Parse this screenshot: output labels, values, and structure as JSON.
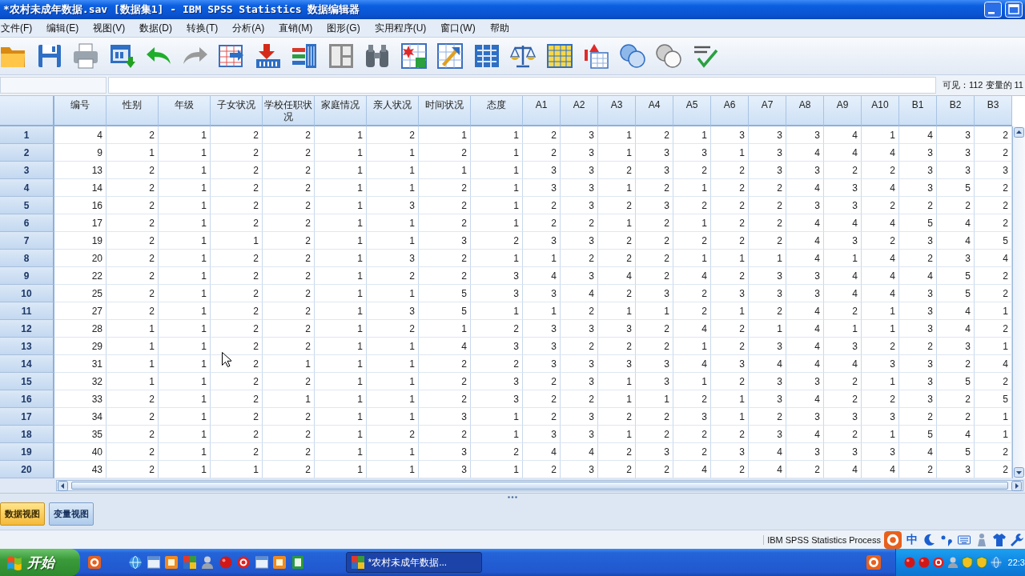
{
  "window": {
    "title": "*农村未成年数据.sav [数据集1] - IBM SPSS Statistics 数据编辑器"
  },
  "menu": [
    "文件(F)",
    "编辑(E)",
    "视图(V)",
    "数据(D)",
    "转换(T)",
    "分析(A)",
    "直销(M)",
    "图形(G)",
    "实用程序(U)",
    "窗口(W)",
    "帮助"
  ],
  "toolbar": [
    {
      "kind": "open",
      "disabled": false
    },
    {
      "kind": "save",
      "disabled": false
    },
    {
      "kind": "print",
      "disabled": false
    },
    {
      "kind": "recall",
      "disabled": false
    },
    {
      "kind": "undo",
      "disabled": false
    },
    {
      "kind": "redo",
      "disabled": true
    },
    {
      "kind": "gotocase",
      "disabled": false
    },
    {
      "kind": "gotovar",
      "disabled": false
    },
    {
      "kind": "variables",
      "disabled": false
    },
    {
      "kind": "descriptives",
      "disabled": true
    },
    {
      "kind": "find",
      "disabled": false
    },
    {
      "kind": "insertcases",
      "disabled": false
    },
    {
      "kind": "insertvar",
      "disabled": false
    },
    {
      "kind": "split",
      "disabled": false
    },
    {
      "kind": "weight",
      "disabled": false
    },
    {
      "kind": "select",
      "disabled": false
    },
    {
      "kind": "labels",
      "disabled": false
    },
    {
      "kind": "sets",
      "disabled": false
    },
    {
      "kind": "showall",
      "disabled": true
    },
    {
      "kind": "spell",
      "disabled": false
    }
  ],
  "cell_editor": {
    "visible": "可见：112 变量的 11"
  },
  "table": {
    "columns": [
      "编号",
      "性别",
      "年级",
      "子女状况",
      "学校任职状况",
      "家庭情况",
      "亲人状况",
      "时间状况",
      "态度",
      "A1",
      "A2",
      "A3",
      "A4",
      "A5",
      "A6",
      "A7",
      "A8",
      "A9",
      "A10",
      "B1",
      "B2",
      "B3"
    ],
    "rows": [
      {
        "label": "1",
        "cells": [
          "4",
          "2",
          "1",
          "2",
          "2",
          "1",
          "2",
          "1",
          "1",
          "2",
          "3",
          "1",
          "2",
          "1",
          "3",
          "3",
          "3",
          "4",
          "1",
          "4",
          "3",
          "2"
        ]
      },
      {
        "label": "2",
        "cells": [
          "9",
          "1",
          "1",
          "2",
          "2",
          "1",
          "1",
          "2",
          "1",
          "2",
          "3",
          "1",
          "3",
          "3",
          "1",
          "3",
          "4",
          "4",
          "4",
          "3",
          "3",
          "2"
        ]
      },
      {
        "label": "3",
        "cells": [
          "13",
          "2",
          "1",
          "2",
          "2",
          "1",
          "1",
          "1",
          "1",
          "3",
          "3",
          "2",
          "3",
          "2",
          "2",
          "3",
          "3",
          "2",
          "2",
          "3",
          "3",
          "3"
        ]
      },
      {
        "label": "4",
        "cells": [
          "14",
          "2",
          "1",
          "2",
          "2",
          "1",
          "1",
          "2",
          "1",
          "3",
          "3",
          "1",
          "2",
          "1",
          "2",
          "2",
          "4",
          "3",
          "4",
          "3",
          "5",
          "2"
        ]
      },
      {
        "label": "5",
        "cells": [
          "16",
          "2",
          "1",
          "2",
          "2",
          "1",
          "3",
          "2",
          "1",
          "2",
          "3",
          "2",
          "3",
          "2",
          "2",
          "2",
          "3",
          "3",
          "2",
          "2",
          "2",
          "2"
        ]
      },
      {
        "label": "6",
        "cells": [
          "17",
          "2",
          "1",
          "2",
          "2",
          "1",
          "1",
          "2",
          "1",
          "2",
          "2",
          "1",
          "2",
          "1",
          "2",
          "2",
          "4",
          "4",
          "4",
          "5",
          "4",
          "2"
        ]
      },
      {
        "label": "7",
        "cells": [
          "19",
          "2",
          "1",
          "1",
          "2",
          "1",
          "1",
          "3",
          "2",
          "3",
          "3",
          "2",
          "2",
          "2",
          "2",
          "2",
          "4",
          "3",
          "2",
          "3",
          "4",
          "5"
        ]
      },
      {
        "label": "8",
        "cells": [
          "20",
          "2",
          "1",
          "2",
          "2",
          "1",
          "3",
          "2",
          "1",
          "1",
          "2",
          "2",
          "2",
          "1",
          "1",
          "1",
          "4",
          "1",
          "4",
          "2",
          "3",
          "4"
        ]
      },
      {
        "label": "9",
        "cells": [
          "22",
          "2",
          "1",
          "2",
          "2",
          "1",
          "2",
          "2",
          "3",
          "4",
          "3",
          "4",
          "2",
          "4",
          "2",
          "3",
          "3",
          "4",
          "4",
          "4",
          "5",
          "2"
        ]
      },
      {
        "label": "10",
        "cells": [
          "25",
          "2",
          "1",
          "2",
          "2",
          "1",
          "1",
          "5",
          "3",
          "3",
          "4",
          "2",
          "3",
          "2",
          "3",
          "3",
          "3",
          "4",
          "4",
          "3",
          "5",
          "2"
        ]
      },
      {
        "label": "11",
        "cells": [
          "27",
          "2",
          "1",
          "2",
          "2",
          "1",
          "3",
          "5",
          "1",
          "1",
          "2",
          "1",
          "1",
          "2",
          "1",
          "2",
          "4",
          "2",
          "1",
          "3",
          "4",
          "1"
        ]
      },
      {
        "label": "12",
        "cells": [
          "28",
          "1",
          "1",
          "2",
          "2",
          "1",
          "2",
          "1",
          "2",
          "3",
          "3",
          "3",
          "2",
          "4",
          "2",
          "1",
          "4",
          "1",
          "1",
          "3",
          "4",
          "2"
        ]
      },
      {
        "label": "13",
        "cells": [
          "29",
          "1",
          "1",
          "2",
          "2",
          "1",
          "1",
          "4",
          "3",
          "3",
          "2",
          "2",
          "2",
          "1",
          "2",
          "3",
          "4",
          "3",
          "2",
          "2",
          "3",
          "1"
        ]
      },
      {
        "label": "14",
        "cells": [
          "31",
          "1",
          "1",
          "2",
          "1",
          "1",
          "1",
          "2",
          "2",
          "3",
          "3",
          "3",
          "3",
          "4",
          "3",
          "4",
          "4",
          "4",
          "3",
          "3",
          "2",
          "4"
        ]
      },
      {
        "label": "15",
        "cells": [
          "32",
          "1",
          "1",
          "2",
          "2",
          "1",
          "1",
          "2",
          "3",
          "2",
          "3",
          "1",
          "3",
          "1",
          "2",
          "3",
          "3",
          "2",
          "1",
          "3",
          "5",
          "2"
        ]
      },
      {
        "label": "16",
        "cells": [
          "33",
          "2",
          "1",
          "2",
          "1",
          "1",
          "1",
          "2",
          "3",
          "2",
          "2",
          "1",
          "1",
          "2",
          "1",
          "3",
          "4",
          "2",
          "2",
          "3",
          "2",
          "5"
        ]
      },
      {
        "label": "17",
        "cells": [
          "34",
          "2",
          "1",
          "2",
          "2",
          "1",
          "1",
          "3",
          "1",
          "2",
          "3",
          "2",
          "2",
          "3",
          "1",
          "2",
          "3",
          "3",
          "3",
          "2",
          "2",
          "1"
        ]
      },
      {
        "label": "18",
        "cells": [
          "35",
          "2",
          "1",
          "2",
          "2",
          "1",
          "2",
          "2",
          "1",
          "3",
          "3",
          "1",
          "2",
          "2",
          "2",
          "3",
          "4",
          "2",
          "1",
          "5",
          "4",
          "1"
        ]
      },
      {
        "label": "19",
        "cells": [
          "40",
          "2",
          "1",
          "2",
          "2",
          "1",
          "1",
          "3",
          "2",
          "4",
          "4",
          "2",
          "3",
          "2",
          "3",
          "4",
          "3",
          "3",
          "3",
          "4",
          "5",
          "2"
        ]
      },
      {
        "label": "20",
        "cells": [
          "43",
          "2",
          "1",
          "1",
          "2",
          "1",
          "1",
          "3",
          "1",
          "2",
          "3",
          "2",
          "2",
          "4",
          "2",
          "4",
          "2",
          "4",
          "4",
          "2",
          "3",
          "2"
        ]
      }
    ]
  },
  "view_tabs": [
    {
      "label": "数据视图",
      "selected": true
    },
    {
      "label": "变量视图",
      "selected": false
    }
  ],
  "status_bar": {
    "text": "IBM SPSS Statistics Process",
    "ime_mode": "中"
  },
  "taskbar": {
    "start": "开始",
    "tasks": [
      {
        "label": "*农村未成年数据...",
        "selected": true
      }
    ],
    "clock": "22:3"
  }
}
